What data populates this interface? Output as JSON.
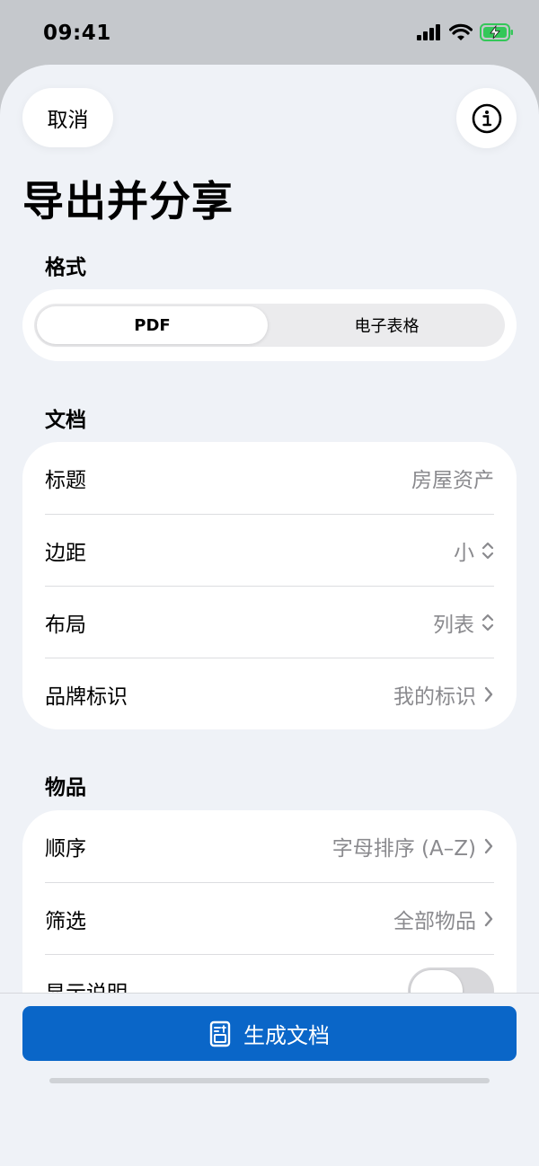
{
  "status_bar": {
    "time": "09:41"
  },
  "header": {
    "cancel_label": "取消",
    "title": "导出并分享"
  },
  "format": {
    "section_label": "格式",
    "options": [
      "PDF",
      "电子表格"
    ],
    "selected": "PDF"
  },
  "document": {
    "section_label": "文档",
    "rows": [
      {
        "label": "标题",
        "value": "房屋资产"
      },
      {
        "label": "边距",
        "value": "小"
      },
      {
        "label": "布局",
        "value": "列表"
      },
      {
        "label": "品牌标识",
        "value": "我的标识"
      }
    ]
  },
  "items": {
    "section_label": "物品",
    "rows": [
      {
        "label": "顺序",
        "value": "字母排序 (A–Z)"
      },
      {
        "label": "筛选",
        "value": "全部物品"
      },
      {
        "label": "显示说明",
        "toggle": false
      }
    ]
  },
  "footer": {
    "generate_label": "生成文档"
  },
  "colors": {
    "accent": "#0a66c8",
    "background": "#eff2f7"
  }
}
